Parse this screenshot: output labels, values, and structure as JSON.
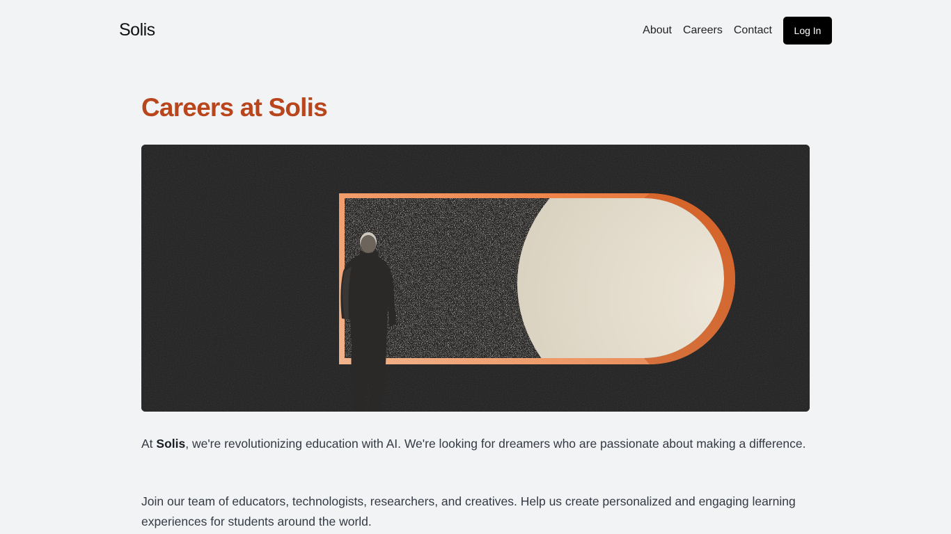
{
  "header": {
    "logo": "Solis",
    "nav": {
      "about": "About",
      "careers": "Careers",
      "contact": "Contact"
    },
    "login_label": "Log In"
  },
  "main": {
    "title": "Careers at Solis",
    "intro": {
      "prefix": "At ",
      "brand": "Solis",
      "suffix": ", we're revolutionizing education with AI. We're looking for dreamers who are passionate about making a difference."
    },
    "paragraph2": "Join our team of educators, technologists, researchers, and creatives. Help us create personalized and engaging learning experiences for students around the world."
  },
  "colors": {
    "background": "#f2f3f5",
    "accent": "#b8451b",
    "button": "#000000"
  }
}
